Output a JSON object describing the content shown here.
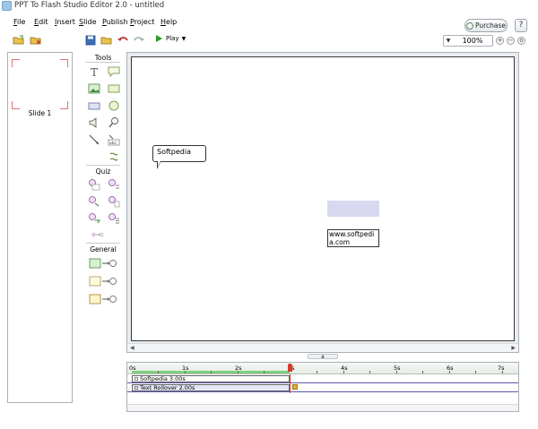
{
  "window": {
    "title": "PPT To Flash Studio Editor 2.0 - untitled"
  },
  "menu": {
    "file": {
      "mnemonic": "F",
      "rest": "ile"
    },
    "edit": {
      "mnemonic": "E",
      "rest": "dit"
    },
    "insert": {
      "mnemonic": "I",
      "rest": "nsert"
    },
    "slide": {
      "mnemonic": "S",
      "rest": "lide"
    },
    "publish": {
      "mnemonic": "P",
      "rest": "ublish"
    },
    "project": {
      "mnemonic": "P",
      "rest": "roject"
    },
    "help": {
      "mnemonic": "H",
      "rest": "elp"
    }
  },
  "header_buttons": {
    "purchase": "Purchase",
    "help": "?"
  },
  "toolbar": {
    "play_label": "Play",
    "zoom": "100%",
    "zoom_in": "+",
    "zoom_out": "−",
    "zoom_fit": "o"
  },
  "slides_panel": {
    "slides": [
      {
        "label": "Slide 1"
      }
    ]
  },
  "tools_panel": {
    "sections": {
      "tools": "Tools",
      "quiz": "Quiz",
      "general": "General"
    },
    "text_tool_glyph": "T",
    "abc": "abc"
  },
  "canvas": {
    "callout_text": "Softpedia",
    "textbox_text": "www.softpedia.com"
  },
  "timeline": {
    "ticks": [
      "0s",
      "1s",
      "2s",
      "3s",
      "4s",
      "5s",
      "6s",
      "7s"
    ],
    "tracks": [
      {
        "label": "Softpedia  3.00s"
      },
      {
        "label": "Text Rollover  2.00s"
      }
    ]
  },
  "colors": {
    "playhead": "#d83a2a",
    "timeline_green": "#7fd07f",
    "slide_corner": "#e07070",
    "rollover_fill": "#d8d8f0"
  }
}
